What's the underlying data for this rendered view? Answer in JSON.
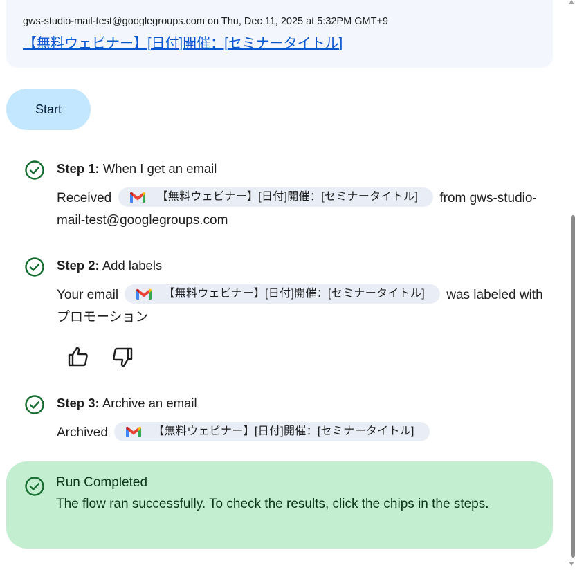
{
  "email": {
    "meta": "gws-studio-mail-test@googlegroups.com on Thu, Dec 11, 2025 at 5:32PM GMT+9",
    "subject": "【無料ウェビナー】[日付]開催：[セミナータイトル]"
  },
  "start": {
    "label": "Start"
  },
  "steps": [
    {
      "number": "Step 1:",
      "title": "When I get an email",
      "prefix": "Received",
      "chip": "【無料ウェビナー】[日付]開催：[セミナータイトル]",
      "suffix": "from gws-studio-mail-test@googlegroups.com"
    },
    {
      "number": "Step 2:",
      "title": "Add labels",
      "prefix": "Your email",
      "chip": "【無料ウェビナー】[日付]開催：[セミナータイトル]",
      "suffix": "was labeled with プロモーション"
    },
    {
      "number": "Step 3:",
      "title": "Archive an email",
      "prefix": "Archived",
      "chip": "【無料ウェビナー】[日付]開催：[セミナータイトル]",
      "suffix": ""
    }
  ],
  "feedback": {
    "up_icon": "thumb-up-icon",
    "down_icon": "thumb-down-icon"
  },
  "run": {
    "title": "Run Completed",
    "description": "The flow ran successfully. To check the results, click the chips in the steps."
  },
  "colors": {
    "link": "#0b57d0",
    "success": "#146c2e",
    "start_bg": "#c2e7ff",
    "run_bg": "#c4eed0",
    "chip_bg": "#e8edf6"
  }
}
